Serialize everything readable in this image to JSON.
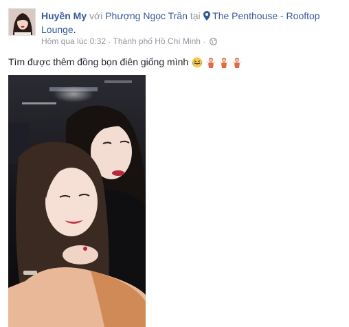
{
  "post": {
    "author": "Huyền My",
    "with_word": "với",
    "tagged_friend": "Phượng Ngọc Trần",
    "at_word": "tại",
    "location_line1": "The Penthouse - Rooftop",
    "location_line2": "Lounge",
    "period": ".",
    "timestamp": "Hôm qua lúc 0:32",
    "separator": "·",
    "place": "Thành phố Hồ Chí Minh",
    "separator2": "·",
    "privacy_icon": "globe-icon",
    "location_icon": "map-pin-icon",
    "text": "Tìm được thêm đồng bọn điên giống mình",
    "emojis": [
      "laughing-emoji",
      "dancing-women-emoji",
      "dancing-women-emoji",
      "dancing-women-emoji"
    ]
  },
  "colors": {
    "link": "#365899",
    "muted": "#90949c",
    "text": "#1d2129"
  }
}
